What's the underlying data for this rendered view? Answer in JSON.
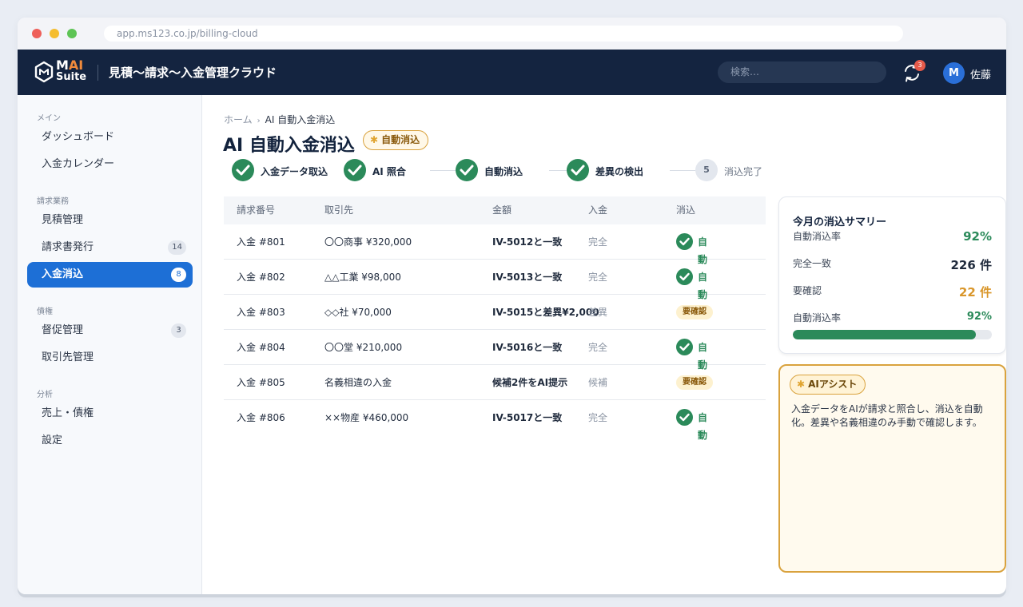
{
  "browser": {
    "url": "app.ms123.co.jp/billing-cloud"
  },
  "header": {
    "logo": {
      "mark": "M",
      "ai": "AI",
      "suite": "Suite"
    },
    "app_title": "見積〜請求〜入金管理クラウド",
    "search_placeholder": "検索…",
    "notification_count": "3",
    "user_initial": "M",
    "user_name": "佐藤"
  },
  "sidebar": {
    "sections": [
      {
        "label": "メイン",
        "items": [
          {
            "label": "ダッシュボード"
          },
          {
            "label": "入金カレンダー"
          }
        ]
      },
      {
        "label": "請求業務",
        "items": [
          {
            "label": "見積管理"
          },
          {
            "label": "請求書発行",
            "badge": "14"
          },
          {
            "label": "入金消込",
            "badge": "8",
            "active": true
          }
        ]
      },
      {
        "label": "債権",
        "items": [
          {
            "label": "督促管理",
            "badge": "3"
          },
          {
            "label": "取引先管理"
          }
        ]
      },
      {
        "label": "分析",
        "items": [
          {
            "label": "売上・債権"
          },
          {
            "label": "設定"
          }
        ]
      }
    ]
  },
  "breadcrumb": {
    "home": "ホーム",
    "separator": "›",
    "current": "AI 自動入金消込"
  },
  "page": {
    "title": "AI 自動入金消込",
    "badge": "自動消込"
  },
  "stepper": {
    "steps": [
      {
        "label": "入金データ取込",
        "status": "done"
      },
      {
        "label": "AI 照合",
        "status": "done"
      },
      {
        "label": "自動消込",
        "status": "done"
      },
      {
        "label": "差異の検出",
        "status": "done"
      },
      {
        "label": "消込完了",
        "number": "5",
        "status": "pending"
      }
    ]
  },
  "table": {
    "columns": [
      "請求番号",
      "取引先",
      "金額",
      "入金",
      "消込"
    ],
    "rows": [
      {
        "id": "入金 #801",
        "partner": "〇〇商事 ¥320,000",
        "amount": "IV-5012と一致",
        "payment": "完全",
        "status": "自動",
        "status_type": "ok"
      },
      {
        "id": "入金 #802",
        "partner": "△△工業 ¥98,000",
        "amount": "IV-5013と一致",
        "payment": "完全",
        "status": "自動",
        "status_type": "ok"
      },
      {
        "id": "入金 #803",
        "partner": "◇◇社 ¥70,000",
        "amount": "IV-5015と差異¥2,000",
        "payment": "差異",
        "status": "要確認",
        "status_type": "warn"
      },
      {
        "id": "入金 #804",
        "partner": "〇〇堂 ¥210,000",
        "amount": "IV-5016と一致",
        "payment": "完全",
        "status": "自動",
        "status_type": "ok"
      },
      {
        "id": "入金 #805",
        "partner": "名義相違の入金",
        "amount": "候補2件をAI提示",
        "payment": "候補",
        "status": "要確認",
        "status_type": "warn"
      },
      {
        "id": "入金 #806",
        "partner": "××物産 ¥460,000",
        "amount": "IV-5017と一致",
        "payment": "完全",
        "status": "自動",
        "status_type": "ok"
      }
    ]
  },
  "summary": {
    "title": "今月の消込サマリー",
    "rows": [
      {
        "label": "自動消込率",
        "value": "92%",
        "tone": "green"
      },
      {
        "label": "完全一致",
        "value": "226 件",
        "tone": "dark"
      },
      {
        "label": "要確認",
        "value": "22 件",
        "tone": "amber"
      }
    ],
    "progress": {
      "label": "自動消込率",
      "value": "92%",
      "fraction": 0.92
    }
  },
  "assist": {
    "badge": "AIアシスト",
    "text": "入金データをAIが請求と照合し、消込を自動化。差異や名義相違のみ手動で確認します。"
  },
  "colors": {
    "navy": "#142440",
    "accent_blue": "#1d6fd6",
    "success": "#2b8a5a",
    "warning": "#d9962a"
  }
}
